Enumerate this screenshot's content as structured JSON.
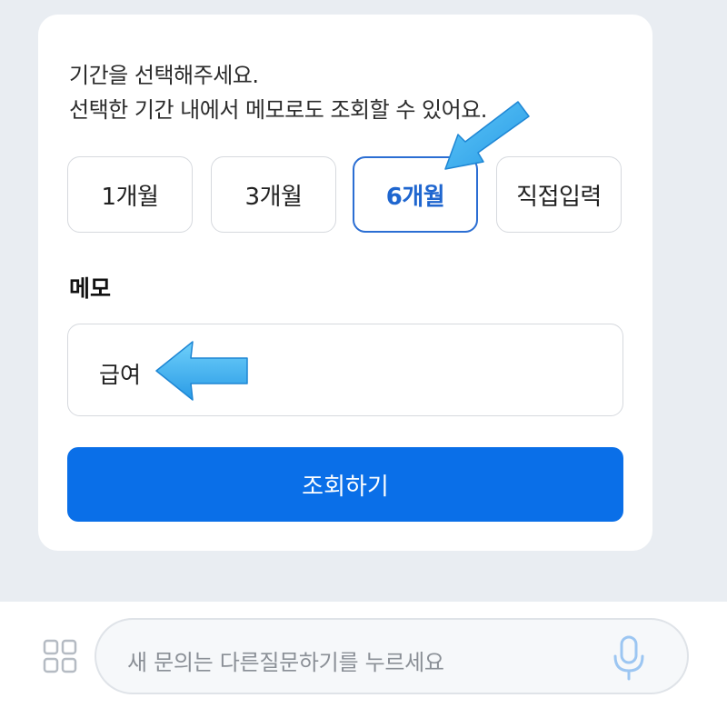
{
  "description": {
    "line1": "기간을 선택해주세요.",
    "line2": "선택한 기간 내에서 메모로도 조회할 수 있어요."
  },
  "periods": {
    "options": [
      "1개월",
      "3개월",
      "6개월",
      "직접입력"
    ],
    "selected": "6개월"
  },
  "memo": {
    "label": "메모",
    "value": "급여"
  },
  "submit_label": "조회하기",
  "chat": {
    "placeholder": "새 문의는 다른질문하기를 누르세요"
  },
  "colors": {
    "accent": "#0a6fe8",
    "selected_border": "#2b6ed3",
    "arrow": "#3db0f0"
  },
  "icons": [
    "grid-menu-icon",
    "microphone-icon",
    "pointer-arrow-icon"
  ]
}
